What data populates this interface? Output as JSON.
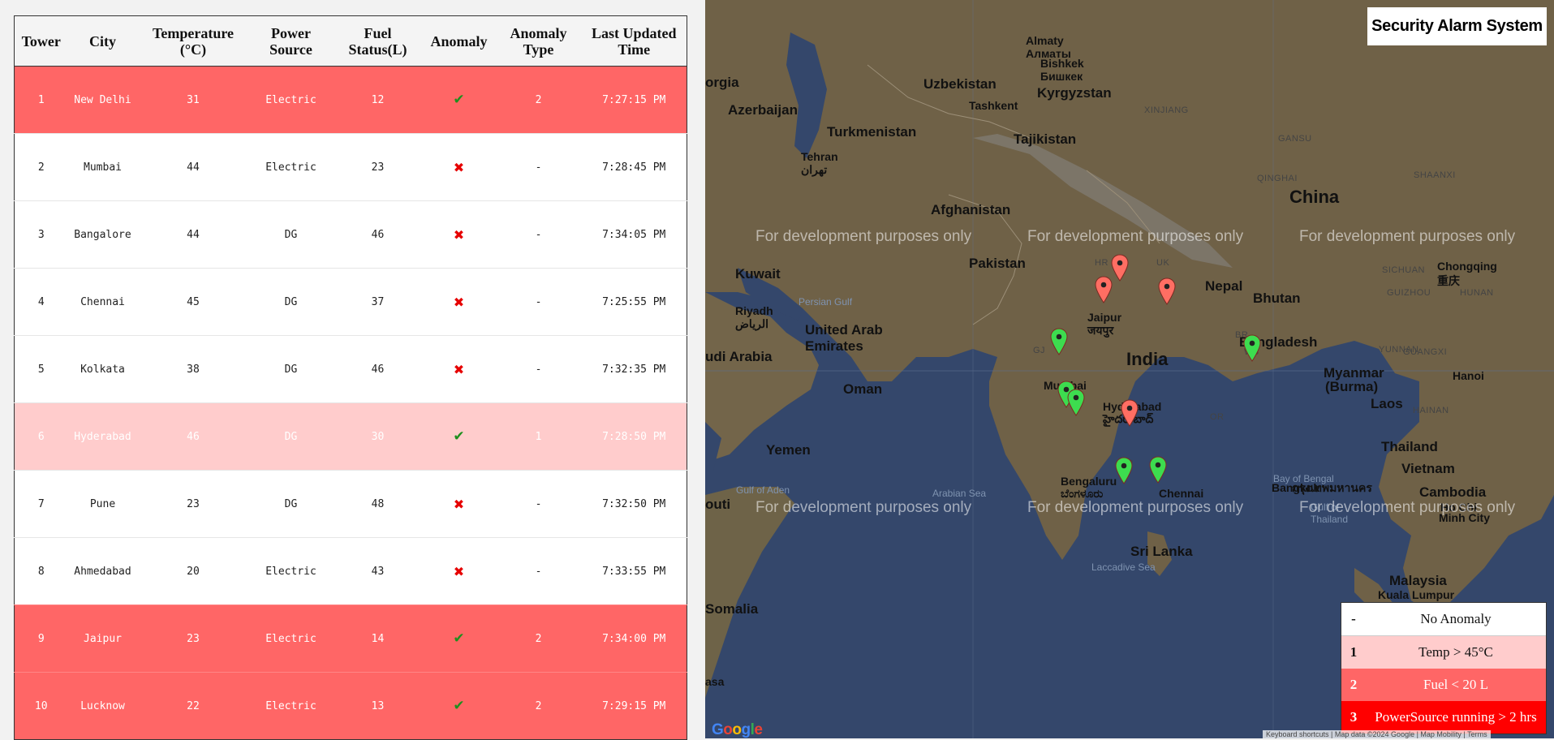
{
  "table": {
    "headers": [
      "Tower",
      "City",
      "Temperature (°C)",
      "Power Source",
      "Fuel Status(L)",
      "Anomaly",
      "Anomaly Type",
      "Last Updated Time"
    ],
    "rows": [
      {
        "tower": "1",
        "city": "New Delhi",
        "temp": "31",
        "power": "Electric",
        "fuel": "12",
        "anomaly": true,
        "type": "2",
        "time": "7:27:15 PM"
      },
      {
        "tower": "2",
        "city": "Mumbai",
        "temp": "44",
        "power": "Electric",
        "fuel": "23",
        "anomaly": false,
        "type": "-",
        "time": "7:28:45 PM"
      },
      {
        "tower": "3",
        "city": "Bangalore",
        "temp": "44",
        "power": "DG",
        "fuel": "46",
        "anomaly": false,
        "type": "-",
        "time": "7:34:05 PM"
      },
      {
        "tower": "4",
        "city": "Chennai",
        "temp": "45",
        "power": "DG",
        "fuel": "37",
        "anomaly": false,
        "type": "-",
        "time": "7:25:55 PM"
      },
      {
        "tower": "5",
        "city": "Kolkata",
        "temp": "38",
        "power": "DG",
        "fuel": "46",
        "anomaly": false,
        "type": "-",
        "time": "7:32:35 PM"
      },
      {
        "tower": "6",
        "city": "Hyderabad",
        "temp": "46",
        "power": "DG",
        "fuel": "30",
        "anomaly": true,
        "type": "1",
        "time": "7:28:50 PM"
      },
      {
        "tower": "7",
        "city": "Pune",
        "temp": "23",
        "power": "DG",
        "fuel": "48",
        "anomaly": false,
        "type": "-",
        "time": "7:32:50 PM"
      },
      {
        "tower": "8",
        "city": "Ahmedabad",
        "temp": "20",
        "power": "Electric",
        "fuel": "43",
        "anomaly": false,
        "type": "-",
        "time": "7:33:55 PM"
      },
      {
        "tower": "9",
        "city": "Jaipur",
        "temp": "23",
        "power": "Electric",
        "fuel": "14",
        "anomaly": true,
        "type": "2",
        "time": "7:34:00 PM"
      },
      {
        "tower": "10",
        "city": "Lucknow",
        "temp": "22",
        "power": "Electric",
        "fuel": "13",
        "anomaly": true,
        "type": "2",
        "time": "7:29:15 PM"
      }
    ],
    "check_symbol": "✔",
    "cross_symbol": "✖"
  },
  "map": {
    "title": "Security Alarm System",
    "watermark": "For development purposes only",
    "labels": [
      {
        "text": "Almaty",
        "cls": "city"
      },
      {
        "text": "Алматы",
        "cls": "city"
      },
      {
        "text": "Bishkek",
        "cls": "city"
      },
      {
        "text": "Бишкек",
        "cls": "city"
      },
      {
        "text": "Uzbekistan",
        "cls": "country"
      },
      {
        "text": "Kyrgyzstan",
        "cls": "country"
      },
      {
        "text": "Tashkent",
        "cls": "city"
      },
      {
        "text": "orgia",
        "cls": "country"
      },
      {
        "text": "Azerbaijan",
        "cls": "country"
      },
      {
        "text": "Turkmenistan",
        "cls": "country"
      },
      {
        "text": "Tajikistan",
        "cls": "country"
      },
      {
        "text": "XINJIANG",
        "cls": "region"
      },
      {
        "text": "GANSU",
        "cls": "region"
      },
      {
        "text": "QINGHAI",
        "cls": "region"
      },
      {
        "text": "SHAANXI",
        "cls": "region"
      },
      {
        "text": "Tehran",
        "cls": "city"
      },
      {
        "text": "تهران",
        "cls": "city"
      },
      {
        "text": "China",
        "cls": "big"
      },
      {
        "text": "Afghanistan",
        "cls": "country"
      },
      {
        "text": "Pakistan",
        "cls": "country"
      },
      {
        "text": "Kuwait",
        "cls": "country"
      },
      {
        "text": "UK",
        "cls": "region"
      },
      {
        "text": "HR",
        "cls": "region"
      },
      {
        "text": "Nepal",
        "cls": "country"
      },
      {
        "text": "SICHUAN",
        "cls": "region"
      },
      {
        "text": "Chongqing",
        "cls": "city"
      },
      {
        "text": "重庆",
        "cls": "city"
      },
      {
        "text": "Bhutan",
        "cls": "country"
      },
      {
        "text": "GUIZHOU",
        "cls": "region"
      },
      {
        "text": "HUNAN",
        "cls": "region"
      },
      {
        "text": "Persian Gulf",
        "cls": "sea"
      },
      {
        "text": "Riyadh",
        "cls": "city"
      },
      {
        "text": "الرياض",
        "cls": "city"
      },
      {
        "text": "Jaipur",
        "cls": "city"
      },
      {
        "text": "जयपुर",
        "cls": "city"
      },
      {
        "text": "United Arab",
        "cls": "country"
      },
      {
        "text": "Emirates",
        "cls": "country"
      },
      {
        "text": "udi Arabia",
        "cls": "country"
      },
      {
        "text": "GJ",
        "cls": "region"
      },
      {
        "text": "BR",
        "cls": "region"
      },
      {
        "text": "Bangladesh",
        "cls": "country"
      },
      {
        "text": "YUNNAN",
        "cls": "region"
      },
      {
        "text": "GUANGXI",
        "cls": "region"
      },
      {
        "text": "WB",
        "cls": "region"
      },
      {
        "text": "India",
        "cls": "big"
      },
      {
        "text": "Myanmar",
        "cls": "country"
      },
      {
        "text": "(Burma)",
        "cls": "country"
      },
      {
        "text": "Hanoi",
        "cls": "city"
      },
      {
        "text": "Oman",
        "cls": "country"
      },
      {
        "text": "Mumbai",
        "cls": "city"
      },
      {
        "text": "Hyderabad",
        "cls": "city"
      },
      {
        "text": "హైదరాబాద్",
        "cls": "city"
      },
      {
        "text": "OR",
        "cls": "region"
      },
      {
        "text": "Laos",
        "cls": "country"
      },
      {
        "text": "HAINAN",
        "cls": "region"
      },
      {
        "text": "Yemen",
        "cls": "country"
      },
      {
        "text": "Thailand",
        "cls": "country"
      },
      {
        "text": "Bay of Bengal",
        "cls": "sea"
      },
      {
        "text": "Vietnam",
        "cls": "country"
      },
      {
        "text": "Bangkok",
        "cls": "city"
      },
      {
        "text": "กรุงเทพมหานคร",
        "cls": "city"
      },
      {
        "text": "Gulf of Aden",
        "cls": "sea"
      },
      {
        "text": "Arabian Sea",
        "cls": "sea"
      },
      {
        "text": "Bengaluru",
        "cls": "city"
      },
      {
        "text": "ಬೆಂಗಳೂರು",
        "cls": "city"
      },
      {
        "text": "Chennai",
        "cls": "city"
      },
      {
        "text": "Cambodia",
        "cls": "country"
      },
      {
        "text": "AP",
        "cls": "region"
      },
      {
        "text": "outi",
        "cls": "country"
      },
      {
        "text": "Ho Chi",
        "cls": "city"
      },
      {
        "text": "Minh City",
        "cls": "city"
      },
      {
        "text": "Gulf of",
        "cls": "sea"
      },
      {
        "text": "Thailand",
        "cls": "sea"
      },
      {
        "text": "Sri Lanka",
        "cls": "country"
      },
      {
        "text": "Laccadive Sea",
        "cls": "sea"
      },
      {
        "text": "Somalia",
        "cls": "country"
      },
      {
        "text": "Malaysia",
        "cls": "country"
      },
      {
        "text": "Kuala Lumpur",
        "cls": "city"
      },
      {
        "text": "asa",
        "cls": "city"
      }
    ],
    "pins": [
      {
        "color": "red",
        "city": "New Delhi"
      },
      {
        "color": "red",
        "city": "Jaipur"
      },
      {
        "color": "red",
        "city": "Lucknow"
      },
      {
        "color": "green",
        "city": "Ahmedabad"
      },
      {
        "color": "green",
        "city": "Kolkata"
      },
      {
        "color": "green",
        "city": "Mumbai"
      },
      {
        "color": "green",
        "city": "Pune"
      },
      {
        "color": "red",
        "city": "Hyderabad"
      },
      {
        "color": "green",
        "city": "Bangalore"
      },
      {
        "color": "green",
        "city": "Chennai"
      }
    ],
    "legend": [
      {
        "key": "-",
        "label": "No Anomaly"
      },
      {
        "key": "1",
        "label": "Temp > 45°C"
      },
      {
        "key": "2",
        "label": "Fuel < 20 L"
      },
      {
        "key": "3",
        "label": "PowerSource running > 2 hrs"
      }
    ],
    "google": "Google",
    "attribution": "Keyboard shortcuts | Map data ©2024 Google | Map Mobility | Terms"
  },
  "colors": {
    "severe": "#ff6666",
    "mild": "#ffcccc",
    "critical": "#ff0000",
    "pin_red": "#ff6e63",
    "pin_green": "#3ddc4f",
    "land": "#6f6147",
    "water": "#34476b"
  }
}
